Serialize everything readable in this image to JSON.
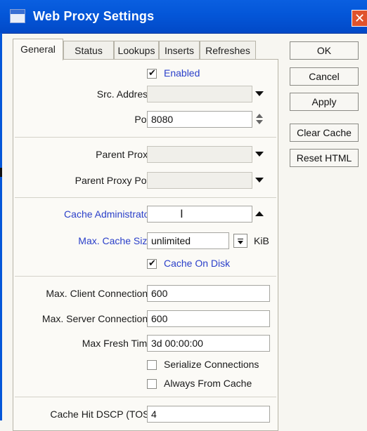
{
  "window": {
    "title": "Web Proxy Settings",
    "close_glyph": "✕"
  },
  "tabs": [
    {
      "label": "General",
      "active": true
    },
    {
      "label": "Status"
    },
    {
      "label": "Lookups"
    },
    {
      "label": "Inserts"
    },
    {
      "label": "Refreshes"
    }
  ],
  "general": {
    "enabled": {
      "label": "Enabled",
      "checked": true
    },
    "src_address": {
      "label": "Src. Address:",
      "value": ""
    },
    "port": {
      "label": "Port:",
      "value": "8080"
    },
    "parent_proxy": {
      "label": "Parent Proxy:",
      "value": ""
    },
    "parent_proxy_port": {
      "label": "Parent Proxy Port:",
      "value": ""
    },
    "cache_administrator": {
      "label": "Cache Administrator:",
      "value": ""
    },
    "max_cache_size": {
      "label": "Max. Cache Size:",
      "value": "unlimited",
      "unit": "KiB"
    },
    "cache_on_disk": {
      "label": "Cache On Disk",
      "checked": true
    },
    "max_client_connections": {
      "label": "Max. Client Connections:",
      "value": "600"
    },
    "max_server_connections": {
      "label": "Max. Server Connections:",
      "value": "600"
    },
    "max_fresh_time": {
      "label": "Max Fresh Time:",
      "value": "3d 00:00:00"
    },
    "serialize_connections": {
      "label": "Serialize Connections",
      "checked": false
    },
    "always_from_cache": {
      "label": "Always From Cache",
      "checked": false
    },
    "cache_hit_dscp": {
      "label": "Cache Hit DSCP (TOS):",
      "value": "4"
    }
  },
  "buttons": {
    "ok": "OK",
    "cancel": "Cancel",
    "apply": "Apply",
    "clear_cache": "Clear Cache",
    "reset_html": "Reset HTML"
  },
  "colors": {
    "titlebar": "#0456d8",
    "highlight_label": "#2a3fc9"
  }
}
